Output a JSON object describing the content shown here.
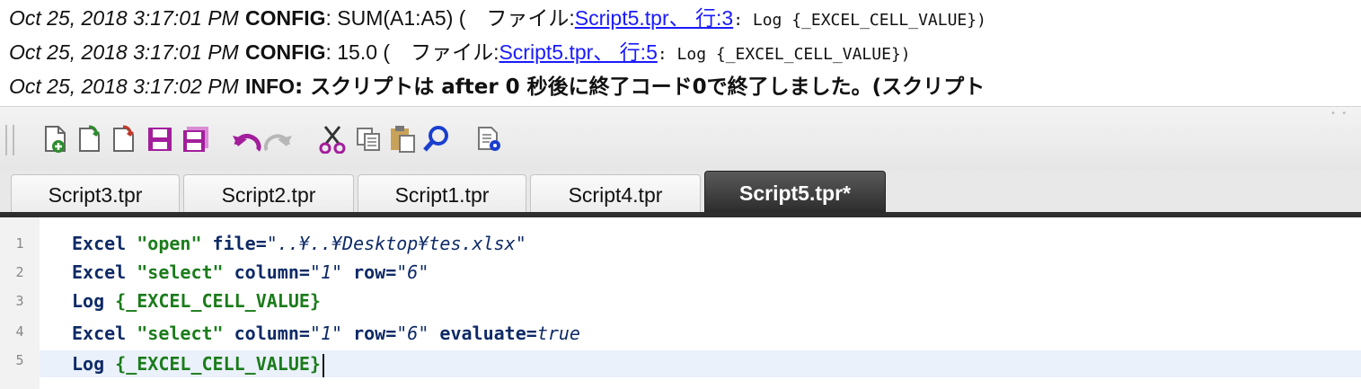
{
  "log": {
    "lines": [
      {
        "time": "Oct 25, 2018 3:17:01 PM",
        "level": "CONFIG",
        "message": ": SUM(A1:A5) (　ファイル:",
        "link": "Script5.tpr、 行:3",
        "tail": ": Log {_EXCEL_CELL_VALUE})"
      },
      {
        "time": "Oct 25, 2018 3:17:01 PM",
        "level": "CONFIG",
        "message": ": 15.0 (　ファイル:",
        "link": "Script5.tpr、 行:5",
        "tail": ": Log {_EXCEL_CELL_VALUE})"
      },
      {
        "time": "Oct 25, 2018 3:17:02 PM",
        "level": "INFO",
        "message": ": スクリプトは after 0 秒後に終了コード0で終了しました。(スクリプト"
      }
    ]
  },
  "toolbar": {
    "icons": [
      "new-file-icon",
      "new-template-icon",
      "open-file-icon",
      "save-icon",
      "save-as-icon",
      "undo-icon",
      "redo-icon",
      "cut-icon",
      "copy-icon",
      "paste-icon",
      "search-icon",
      "settings-icon"
    ]
  },
  "tabs": [
    {
      "label": "Script3.tpr",
      "active": false
    },
    {
      "label": "Script2.tpr",
      "active": false
    },
    {
      "label": "Script1.tpr",
      "active": false
    },
    {
      "label": "Script4.tpr",
      "active": false
    },
    {
      "label": "Script5.tpr*",
      "active": true
    }
  ],
  "editor": {
    "line_numbers": [
      "1",
      "2",
      "3",
      "4",
      "5"
    ],
    "lines": [
      {
        "cmd": "Excel",
        "action": "\"open\"",
        "p1": " file=",
        "v1": "\"..¥..¥Desktop¥tes.xlsx\""
      },
      {
        "cmd": "Excel",
        "action": "\"select\"",
        "p1": " column=",
        "v1": "\"1\"",
        "p2": " row=",
        "v2": "\"6\""
      },
      {
        "cmd": "Log",
        "var": "{_EXCEL_CELL_VALUE}"
      },
      {
        "cmd": "Excel",
        "action": "\"select\"",
        "p1": " column=",
        "v1": "\"1\"",
        "p2": " row=",
        "v2": "\"6\"",
        "p3": " evaluate=",
        "v3": "true"
      },
      {
        "cmd": "Log",
        "var": "{_EXCEL_CELL_VALUE}"
      }
    ]
  },
  "colors": {
    "code_keyword": "#0e2a66",
    "code_string": "#1b7c1b",
    "link": "#1a1aff",
    "active_tab": "#2a2a2a"
  }
}
